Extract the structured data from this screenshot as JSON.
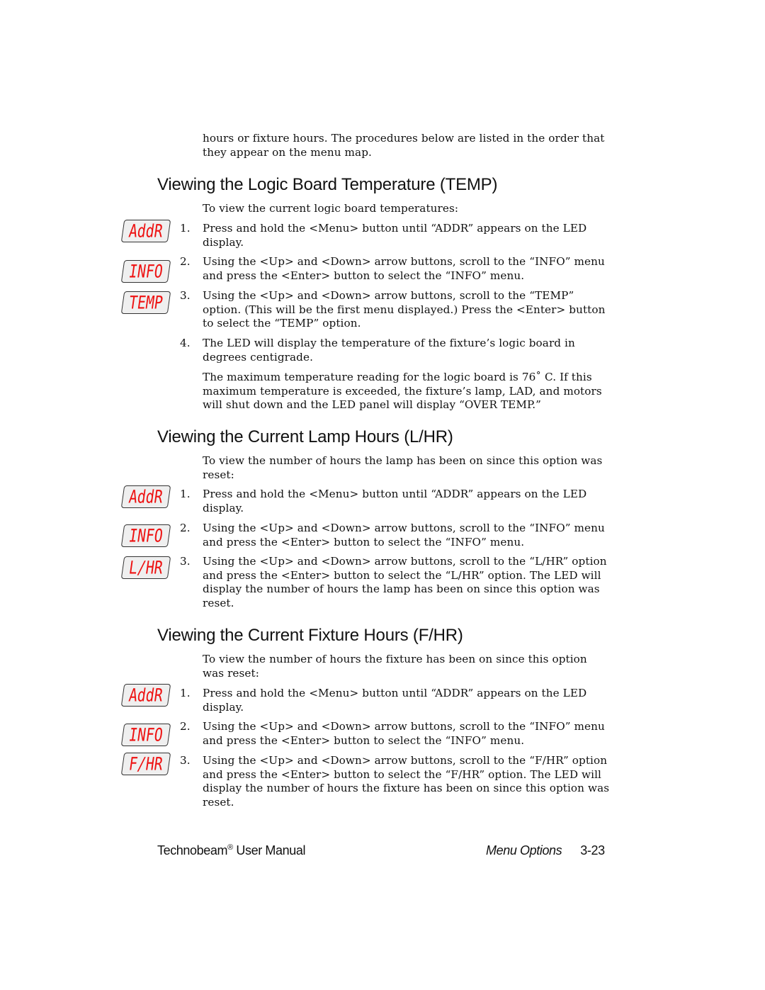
{
  "intro": {
    "text": "hours or fixture hours.  The procedures below are listed in the order that they appear on the menu map."
  },
  "sections": [
    {
      "heading": "Viewing the Logic Board Temperature (TEMP)",
      "intro": "To view the current logic board temperatures:",
      "led_displays": [
        "AddR",
        "INFO",
        "TEMP"
      ],
      "steps": [
        {
          "num": "1.",
          "text": "Press and hold the <Menu> button until “ADDR” appears on the LED display."
        },
        {
          "num": "2.",
          "text": "Using the <Up> and <Down> arrow buttons, scroll to the “INFO” menu and press the <Enter> button to select the “INFO” menu."
        },
        {
          "num": "3.",
          "text": "Using the <Up> and <Down> arrow buttons, scroll to the “TEMP” option. (This will be the first menu displayed.)  Press the <Enter> button to select the “TEMP” option."
        },
        {
          "num": "4.",
          "text": "The LED will display the temperature of the fixture’s logic board in degrees centigrade."
        }
      ],
      "note": "The maximum temperature reading for the logic board is 76˚ C.  If this maximum temperature is exceeded, the fixture’s lamp, LAD, and motors will shut down and the LED panel will display “OVER TEMP.”"
    },
    {
      "heading": "Viewing the Current Lamp Hours (L/HR)",
      "intro": "To view the number of hours the lamp has been on since this option was reset:",
      "led_displays": [
        "AddR",
        "INFO",
        "L/HR"
      ],
      "steps": [
        {
          "num": "1.",
          "text": "Press and hold the <Menu> button until “ADDR” appears on the LED display."
        },
        {
          "num": "2.",
          "text": "Using the <Up> and <Down> arrow buttons, scroll to the “INFO” menu and press the <Enter> button to select the “INFO” menu."
        },
        {
          "num": "3.",
          "text": "Using the <Up> and <Down> arrow buttons, scroll to the “L/HR” option and press the <Enter> button to select the “L/HR” option.  The LED will display the number of hours the lamp has been on since this option was reset."
        }
      ]
    },
    {
      "heading": "Viewing the Current Fixture Hours (F/HR)",
      "intro": "To view the number of hours the fixture has been on since this option was reset:",
      "led_displays": [
        "AddR",
        "INFO",
        "F/HR"
      ],
      "steps": [
        {
          "num": "1.",
          "text": "Press and hold the <Menu> button until “ADDR” appears on the LED display."
        },
        {
          "num": "2.",
          "text": "Using the <Up> and <Down> arrow buttons, scroll to the “INFO” menu and press the <Enter> button to select the “INFO” menu."
        },
        {
          "num": "3.",
          "text": "Using the <Up> and <Down> arrow buttons, scroll to the “F/HR” option and press the <Enter> button to select the “F/HR” option.  The LED will display the number of hours the fixture has been on since this option was reset."
        }
      ]
    }
  ],
  "footer": {
    "manual_title": "Technobeam",
    "registered_mark": "®",
    "manual_suffix": " User Manual",
    "section_name": "Menu Options",
    "page_number": "3-23"
  },
  "colors": {
    "led_text": "#ee1111",
    "led_background": "#efefef",
    "led_border": "#333333"
  }
}
